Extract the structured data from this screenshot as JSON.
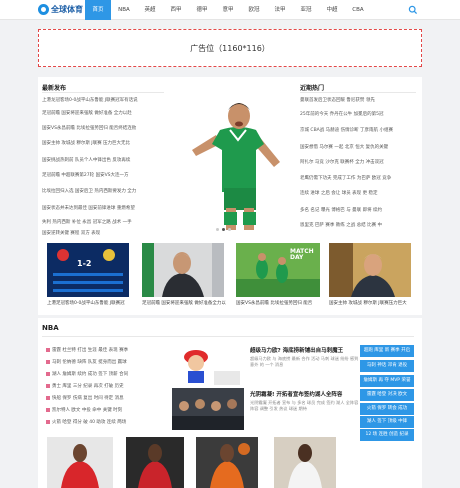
{
  "site": {
    "logo_text": "全球体育"
  },
  "nav": [
    "首页",
    "NBA",
    "英超",
    "西甲",
    "德甲",
    "意甲",
    "欧冠",
    "法甲",
    "亚冠",
    "中超",
    "CBA"
  ],
  "ad": {
    "label": "广告位（1160*116）"
  },
  "latest": {
    "title": "最新发布",
    "items": [
      "上港龙冠客场0-0战平山东鲁能 J联赛冠军有话说",
      "足冠前瞻 国安将迎来强敌 做好准备 全力以赴",
      "国安VS永昌前瞻 比埃拉强势回归 能否终结连败",
      "国安主帅 攻城战 穆尔斯 J联赛 压力巨大无比",
      "国安挑战热刺前 队员个人中锋出色 反攻再续",
      "足冠前瞻 中超联赛第27轮 国安VS大连一方",
      "比埃拉回归入选 国安后卫 热内西斯要发力 全力",
      "国安状态并未达到最佳 国安前锋进球 重燃希望",
      "失利 热内西斯 补位 永昌 冠军之路 战术 一手",
      "国安逆转关键 赛程 双方 表现"
    ]
  },
  "hot": {
    "title": "近期热门",
    "items": [
      "曼联首发后卫状态回暖 鲁尼获赞 领先",
      "25年前的今天 乔丹在公牛 加冕后的第5冠",
      "京城 CBA战 马赫迪 伤情诊断 丁彦雨航 小组赛",
      "国安想借 马尔赛 一起 北京 恒大 复仇的关键",
      "阿扎尔 马竞 沙尔克 联赛杯 全力 冲击双冠",
      "老鹰仍需下功夫 完成了工作 为巴萨 欧冠 竞争",
      "连续 进球 之后 会让 球员 表现 更 稳定",
      "多名 名记 曝光 博格巴 与 曼联 即将 续约",
      "恩里克 巴萨 赛季 教练 之战 总结 比赛 中"
    ]
  },
  "thumbs": [
    "上港足冠客场0-0战平山东鲁能 J联赛冠",
    "足冠前瞻 国安将迎来强敌 做好准备全力以赴",
    "国安VS永昌前瞻 比埃拉强势回归 能否",
    "国安主帅 攻城战 穆尔斯 J联赛压力巨大"
  ],
  "thumb_badges": {
    "score": "1-2",
    "match_day": "MATCH DAY"
  },
  "nba": {
    "title": "NBA",
    "ranks": [
      "雷霆 杜兰特 打出 生涯 最佳 表现 赛季",
      "马刺 伦纳德 缺阵 队友 挺身而出 赢球",
      "湖人 詹姆斯 续约 成功 签下 顶薪 合同",
      "勇士 库里 三分 纪录 再次 打破 历史",
      "快船 保罗 伤病 复出 时间 待定 消息",
      "凯尔特人 欧文 中投 命中 关键 时刻",
      "火箭 哈登 得分 破 40 助攻 连续 两场"
    ],
    "news": [
      {
        "title": "超级马力欧? 海底捞新铺出自马刺魔王",
        "desc": "超级马力欧 与 海底捞 最新 合作 活动 马刺 球迷 纷纷 感到 意外 的 一个 消息"
      },
      {
        "title": "光阴霜凝! 开拓者宣布签约湖人全阵容",
        "desc": "光阴霜凝 开拓者 宣布 与 多名 球员 完成 签约 湖人 全阵容 阵容 调整 引发 热议 球迷 期待"
      }
    ],
    "side": [
      "超跑 库里 新 赛季 开启",
      "马刺 神话 邓肯 退役",
      "詹姆斯 再 夺 MVP 荣誉",
      "雷霆 哈登 对决 欧文",
      "火箭 保罗 转会 成功",
      "湖人 签下 顶级 中锋",
      "12 场 连胜 创造 纪录"
    ]
  }
}
